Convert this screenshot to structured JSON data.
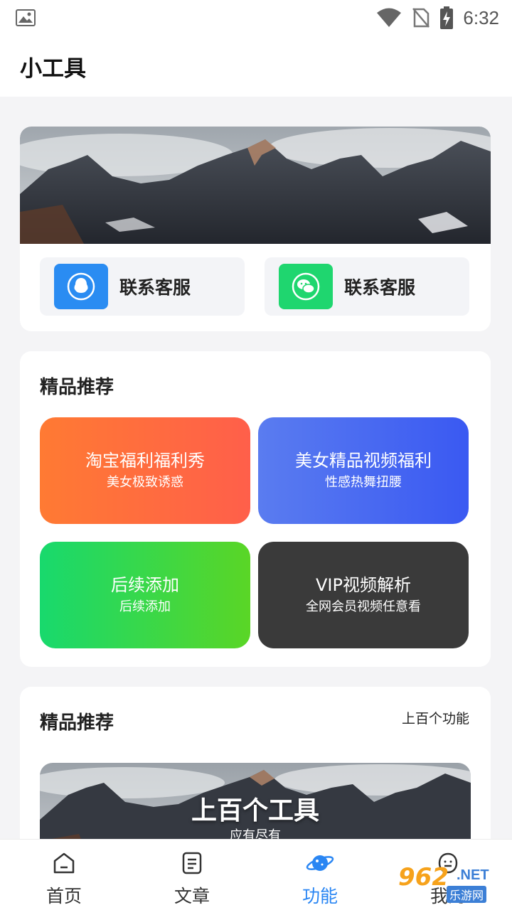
{
  "status_bar": {
    "time": "6:32",
    "icons": [
      "image-icon",
      "wifi-icon",
      "no-sim-icon",
      "battery-charging-icon"
    ]
  },
  "app_bar": {
    "title": "小工具"
  },
  "top_card": {
    "contacts": [
      {
        "label": "联系客服",
        "icon": "qq-icon",
        "color": "#2a8cf2"
      },
      {
        "label": "联系客服",
        "icon": "wechat-icon",
        "color": "#1fd66f"
      }
    ]
  },
  "recommend": {
    "title": "精品推荐",
    "tiles": [
      {
        "title": "淘宝福利福利秀",
        "subtitle": "美女极致诱惑"
      },
      {
        "title": "美女精品视频福利",
        "subtitle": "性感热舞扭腰"
      },
      {
        "title": "后续添加",
        "subtitle": "后续添加"
      },
      {
        "title": "VIP视频解析",
        "subtitle": "全网会员视频任意看"
      }
    ]
  },
  "recommend2": {
    "title": "精品推荐",
    "more": "上百个功能",
    "banner_title": "上百个工具",
    "banner_subtitle": "应有尽有"
  },
  "bottom_nav": {
    "items": [
      {
        "label": "首页",
        "icon": "home-icon"
      },
      {
        "label": "文章",
        "icon": "article-icon"
      },
      {
        "label": "功能",
        "icon": "planet-icon",
        "active": true
      },
      {
        "label": "我的",
        "icon": "profile-icon"
      }
    ],
    "active_color": "#2a86f3"
  },
  "watermark": {
    "num": "962",
    "net": ".NET",
    "cn": "乐游网"
  }
}
